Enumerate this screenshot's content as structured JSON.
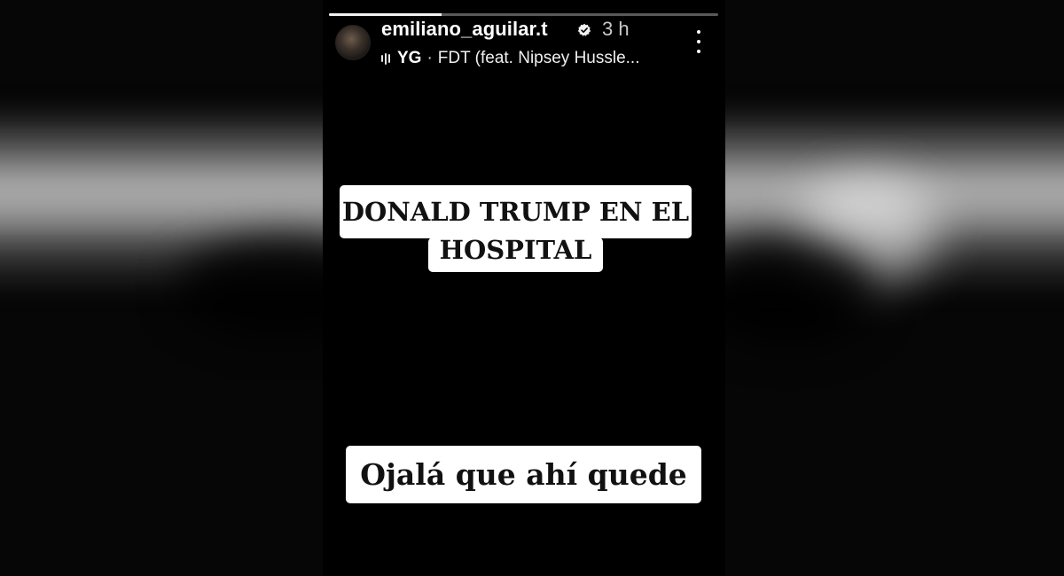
{
  "story": {
    "username": "emiliano_aguilar.t",
    "time_ago": "3 h",
    "progress": 0.29,
    "music": {
      "artist": "YG",
      "separator": "·",
      "track": "FDT (feat. Nipsey Hussle..."
    },
    "icons": {
      "verified": "verified-badge-icon",
      "music": "audio-bars-icon",
      "menu": "more-vertical-icon"
    },
    "captions": {
      "headline_line1": "DONALD TRUMP EN EL",
      "headline_line2": "HOSPITAL",
      "reply": "Ojalá que ahí quede"
    },
    "colors": {
      "background": "#000000",
      "sticker_bg": "#ffffff",
      "sticker_text": "#111111",
      "text": "#ffffff"
    }
  }
}
